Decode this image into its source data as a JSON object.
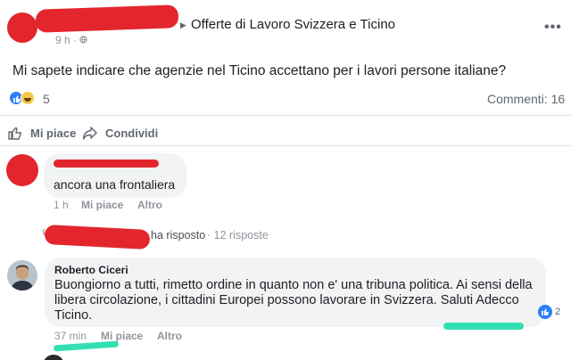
{
  "post": {
    "group_arrow": "▶",
    "group_name": "Offerte di Lavoro Svizzera e Ticino",
    "time": "9 h · ",
    "more_icon": "•••",
    "text": "Mi sapete indicare che agenzie nel Ticino accettano per i lavori persone italiane?",
    "reaction_count": "5",
    "comments_label": "Commenti: 16"
  },
  "actions": {
    "like_label": "Mi piace",
    "share_label": "Condividi"
  },
  "comment1": {
    "text": "ancora una frontaliera",
    "time": "1 h",
    "like": "Mi piace",
    "reply": "Altro"
  },
  "replies": {
    "replied": "ha risposto",
    "count": "· 12 risposte"
  },
  "comment2": {
    "name": "Roberto Ciceri",
    "text": "Buongiorno a tutti, rimetto ordine in quanto non e' una tribuna politica. Ai sensi della libera circolazione, i cittadini Europei possono lavorare in Svizzera. Saluti Adecco Ticino.",
    "reaction_count": "2",
    "time": "37 min",
    "like": "Mi piace",
    "reply": "Altro"
  },
  "colors": {
    "redaction": "#e3262d",
    "highlight": "#33e0b4",
    "like_blue": "#2d7ff9"
  }
}
